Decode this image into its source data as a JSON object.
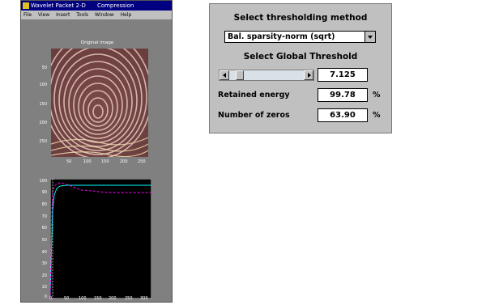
{
  "window": {
    "title": "Wavelet Packet 2-D",
    "subtitle": "Compression",
    "menu": [
      "File",
      "View",
      "Insert",
      "Tools",
      "Window",
      "Help"
    ]
  },
  "image_plot": {
    "title": "Original image",
    "yticks": [
      "50",
      "100",
      "150",
      "200",
      "250"
    ],
    "xticks": [
      "50",
      "100",
      "150",
      "200",
      "250"
    ]
  },
  "curve_plot": {
    "yticks": [
      "100",
      "90",
      "80",
      "70",
      "60",
      "50",
      "40",
      "30",
      "20",
      "10",
      "0"
    ],
    "xticks": [
      "0",
      "50",
      "100",
      "150",
      "200",
      "250",
      "300"
    ],
    "colors": {
      "background": "#000000",
      "energy": "#00ffff",
      "zeros": "#ff00ff",
      "axis": "#ffffff"
    }
  },
  "dialog": {
    "method_label": "Select thresholding method",
    "method_value": "Bal. sparsity-norm (sqrt)",
    "threshold_label": "Select Global Threshold",
    "threshold_value": "7.125",
    "threshold_slider_position": 0.1,
    "energy_label": "Retained energy",
    "energy_value": "99.78",
    "energy_unit": "%",
    "zeros_label": "Number of zeros",
    "zeros_value": "63.90",
    "zeros_unit": "%"
  }
}
